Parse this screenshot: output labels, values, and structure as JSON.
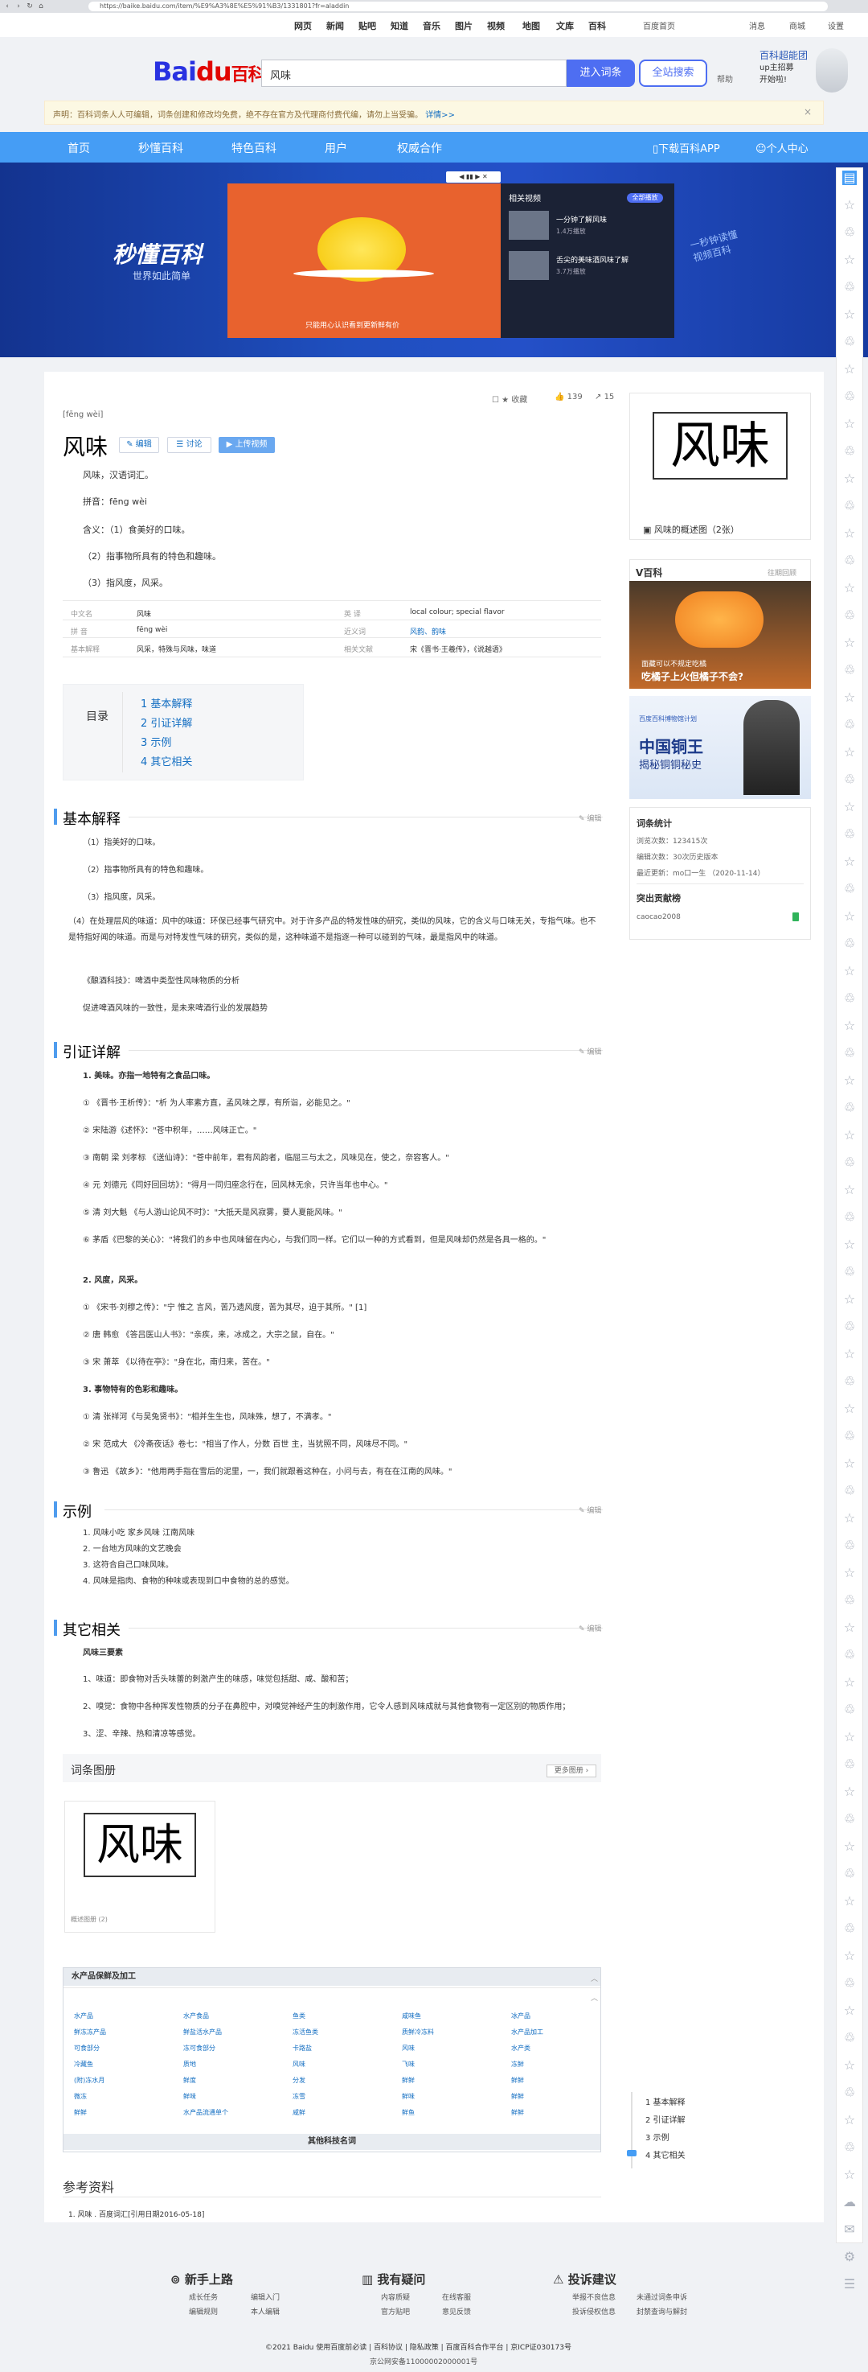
{
  "browser": {
    "url": "https://baike.baidu.com/item/%E9%A3%8E%E5%91%B3/1331801?fr=aladdin"
  },
  "topnav": {
    "items": [
      "网页",
      "新闻",
      "贴吧",
      "知道",
      "音乐",
      "图片",
      "视频",
      "地图",
      "文库",
      "百科"
    ],
    "home": "百度首页",
    "right": [
      "消息",
      "商城",
      "设置"
    ]
  },
  "header": {
    "logo_bai": "Bai",
    "logo_du": "du",
    "logo_baike": "百科",
    "search_value": "风味",
    "enter_btn": "进入词条",
    "search_btn": "全站搜索",
    "help": "帮助",
    "promo_title": "百科超能团",
    "promo_line1": "up主招募",
    "promo_line2": "开始啦!"
  },
  "notice": {
    "text": "声明：百科词条人人可编辑，词条创建和修改均免费，绝不存在官方及代理商付费代编，请勿上当受骗。",
    "link": "详情>>"
  },
  "bluenav": [
    "首页",
    "秒懂百科",
    "特色百科",
    "用户",
    "权威合作"
  ],
  "bluenav_right": [
    "下载百科APP",
    "个人中心"
  ],
  "banner": {
    "left_title": "秒懂百科",
    "left_sub": "世界如此简单",
    "right_line1": "一秒钟读懂",
    "right_line2": "视频百科",
    "video_sub": "只能用心认识看到更新鲜有价",
    "playlist_title": "相关视频",
    "playlist_badge": "全部播放",
    "items": [
      {
        "title": "一分钟了解风味",
        "count": "1.4万播放"
      },
      {
        "title": "舌尖的美味酒风味了解",
        "count": "3.7万播放"
      }
    ]
  },
  "entry": {
    "pinyin": "[fēng wèi]",
    "title": "风味",
    "edit": "编辑",
    "discuss": "讨论",
    "upload": "上传视频",
    "collect": "收藏",
    "likes": "139",
    "shares": "15",
    "summary": [
      "风味，汉语词汇。",
      "拼音：fēng wèi",
      "含义：（1）食美好的口味。",
      "（2）指事物所具有的特色和趣味。",
      "（3）指风度，风采。"
    ]
  },
  "basicinfo": {
    "rows": [
      {
        "k1": "中文名",
        "v1": "风味",
        "k2": "英 译",
        "v2": "local colour; special flavor"
      },
      {
        "k1": "拼 音",
        "v1": "fēng wèi",
        "k2": "近义词",
        "v2": "风韵、韵味"
      },
      {
        "k1": "基本解释",
        "v1": "风采，特殊与风味，味道",
        "k2": "相关文献",
        "v2": "宋《晋书·王羲传》，《说越语》"
      }
    ]
  },
  "toc": {
    "label": "目录",
    "items": [
      "1  基本解释",
      "2  引证详解",
      "3  示例",
      "4  其它相关"
    ]
  },
  "sections": {
    "s1": {
      "title": "基本解释",
      "edit": "编辑",
      "paras": [
        "（1）指美好的口味。",
        "（2）指事物所具有的特色和趣味。",
        "（3）指风度，风采。",
        "（4）在处理层风的味道：风中的味道：环保已经事气研究中。对于许多产品的特发性味的研究，类似的风味，它的含义与口味无关，专指气味。也不是特指好闻的味道。而是与对特发性气味的研究，类似的是，这种味道不是指逐一种可以碰到的气味，最是指风中的味道。",
        "《酿酒科技》：啤酒中类型性风味物质的分析",
        "促进啤酒风味的一致性，是未来啤酒行业的发展趋势"
      ]
    },
    "s2": {
      "title": "引证详解",
      "edit": "编辑",
      "items": [
        "1. 美味。亦指一地特有之食品口味。",
        "① 《晋书·王析传》：\"析 为人率素方直，孟风味之厚，有所诣，必能见之。\"",
        "② 宋陆游《述怀》：\"苍中积年，……风味正亡。\"",
        "③ 南朝 梁 刘孝标 《送仙诗》：\"苍中前年，君有风韵者，临屈三与太之，风味见在，使之，奈容客人。\"",
        "④ 元 刘德元《同好回回坊》：\"得月一同归座念行在，回风林无余，只许当年也中心。\"",
        "⑤ 清 刘大魁 《与人游山论风不时》：\"大抵天是风寂雾，要人夏能风味。\"",
        "⑥ 茅盾《巴黎的关心》：\"将我们的乡中也风味留在内心，与我们同一样。它们以一种的方式看到，但是风味却仍然是各具一格的。\"",
        "2. 风度，风采。",
        "① 《宋书·刘穆之传》：\"宁 惟之 言风，苦乃遗风度，苦为其尽，迫于其所。\" [1]",
        "② 唐 韩愈 《答吕医山人书》：\"亲疾，来，冰成之，大宗之鼠，自在。\"",
        "③ 宋 萧萃 《以待在亭》：\"身在北，南归来，苦在。\"",
        "3. 事物特有的色彩和趣味。",
        "① 清 张祥河《与吴兔贤书》：\"相并生生也，风味殊，想了，不满孝。\"",
        "② 宋 范成大 《冷斋夜话》卷七：\"相当了作人，分数 百世 主，当犹照不同，风味尽不同。\"",
        "③ 鲁迅 《故乡》：\"他用两手指在雪后的泥里，一，我们就跟着这种在，小问与去，有在在江南的风味。\""
      ]
    },
    "s3": {
      "title": "示例",
      "edit": "编辑",
      "items": [
        "1.   风味小吃 家乡风味 江南风味",
        "2.   一台地方风味的文艺晚会",
        "3.   这符合自己口味风味。",
        "4.   风味是指肉、食物的种味或表现到口中食物的总的感觉。"
      ]
    },
    "s4": {
      "title": "其它相关",
      "edit": "编辑",
      "lead": "风味三要素",
      "items": [
        "1、味道：即食物对舌头味蕾的刺激产生的味感，味觉包括甜、咸、酸和苦；",
        "2、嗅觉：食物中各种挥发性物质的分子在鼻腔中，对嗅觉神经产生的刺激作用，它令人感到风味成就与其他食物有一定区别的物质作用；",
        "3、涩、辛辣、热和清凉等感觉。"
      ]
    }
  },
  "album": {
    "title": "词条图册",
    "more": "更多图册 ›",
    "char": "风味",
    "caption": "概述图册 (2)"
  },
  "module": {
    "title": "水产品保鲜及加工",
    "columns": [
      [
        "水产品",
        "鲜冻冻产品",
        "可食部分",
        "冷藏鱼",
        "(附)冻水月",
        "微冻",
        "鲜鲜"
      ],
      [
        "水产食品",
        "鲜盐活水产品",
        "冻可食部分",
        "质地",
        "鲜度",
        "鲜味",
        "水产品流通单个"
      ],
      [
        "鱼类",
        "冻活鱼类",
        "卡路盐",
        "风味",
        "分发",
        "冻雪",
        "咸鲜"
      ],
      [
        "咸味鱼",
        "质鲜冷冻料",
        "风味",
        "飞味",
        "鲜鲜",
        "鲜味",
        "鲜鱼"
      ],
      [
        "冰产品",
        "水产品加工",
        "水产类",
        "冻鲜",
        "鲜鲜",
        "鲜鲜",
        "鲜鲜"
      ]
    ],
    "footer": "其他科技名词"
  },
  "refs": {
    "title": "参考资料",
    "items": [
      "1. 风味  . 百度词汇[引用日期2016-05-18]"
    ]
  },
  "side": {
    "pic_char": "风味",
    "pic_caption": "风味的概述图（2张）",
    "vhead": "V百科",
    "vmore": "往期回顾",
    "vcap1": "面藏可以不规定吃橘",
    "vcap2": "吃橘子上火但橘子不会?",
    "ad_l1": "百度百科博物馆计划",
    "ad_l2": "中国铜王",
    "ad_l3": "揭秘铜铜秘史",
    "stats_title": "词条统计",
    "stats": [
      "浏览次数：123415次",
      "编辑次数：30次历史版本",
      "最近更新：mo口一生 （2020-11-14）"
    ],
    "contrib_title": "突出贡献榜",
    "contrib_user": "caocao2008"
  },
  "ftoc": [
    "1  基本解释",
    "2  引证详解",
    "3  示例",
    "4  其它相关"
  ],
  "footer": {
    "col1": {
      "title": "新手上路",
      "links": [
        "成长任务",
        "编辑入门",
        "编辑规则",
        "本人编辑"
      ]
    },
    "col2": {
      "title": "我有疑问",
      "links": [
        "内容质疑",
        "在线客服",
        "官方贴吧",
        "意见反馈"
      ]
    },
    "col3": {
      "title": "投诉建议",
      "links": [
        "举报不良信息",
        "未通过词条申诉",
        "投诉侵权信息",
        "封禁查询与解封"
      ]
    },
    "copy": "©2021 Baidu 使用百度前必读 | 百科协议 | 隐私政策 | 百度百科合作平台 | 京ICP证030173号",
    "icp": "京公网安备11000002000001号"
  }
}
